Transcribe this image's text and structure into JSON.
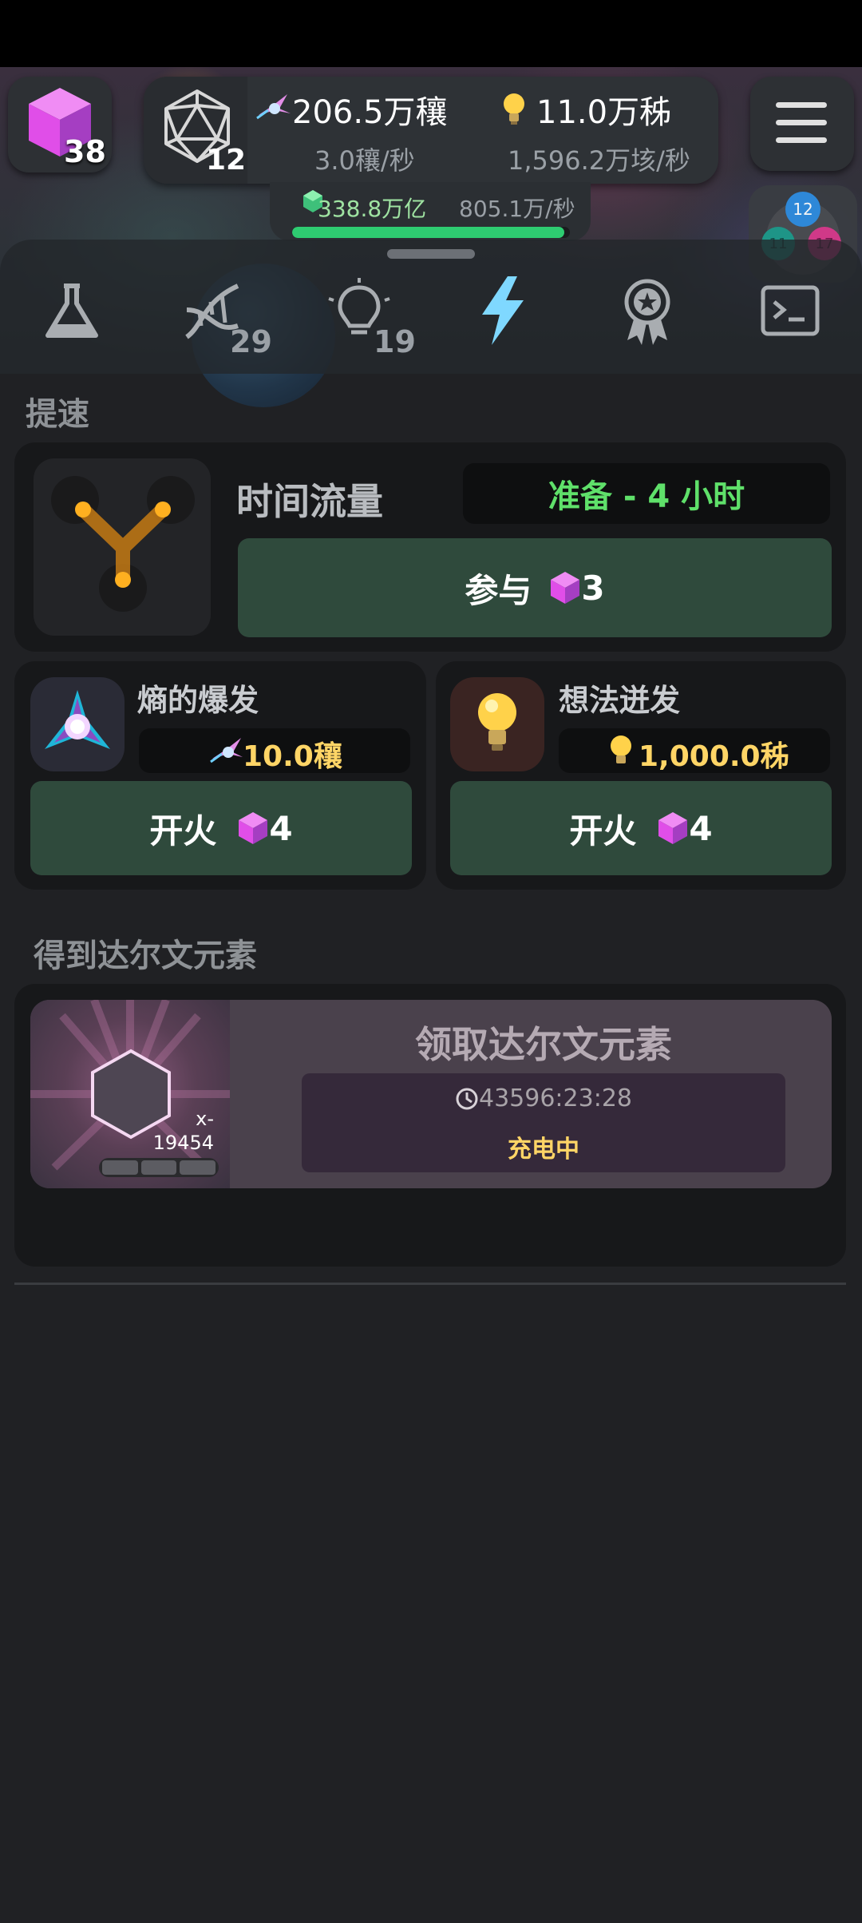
{
  "header": {
    "gem_count": "38",
    "d20_count": "12",
    "entropy_amount": "206.5万穰",
    "entropy_rate": "3.0穰/秒",
    "ideas_amount": "11.0万秭",
    "ideas_rate": "1,596.2万垓/秒",
    "gold_amount": "338.8万亿",
    "gold_rate": "805.1万/秒",
    "gold_progress": 0.98,
    "player_badge_top": "12",
    "player_badge_left": "11",
    "player_badge_right": "17"
  },
  "tabs": [
    {
      "icon": "flask-icon",
      "count": ""
    },
    {
      "icon": "dna-icon",
      "count": "29"
    },
    {
      "icon": "lightbulb-icon",
      "count": "19"
    },
    {
      "icon": "lightning-icon",
      "count": "",
      "active": true
    },
    {
      "icon": "award-icon",
      "count": ""
    },
    {
      "icon": "terminal-icon",
      "count": ""
    }
  ],
  "boost": {
    "section_title": "提速",
    "time_flow": {
      "title": "时间流量",
      "status": "准备 - 4 小时",
      "button_label": "参与",
      "cost": "3"
    },
    "entropy_burst": {
      "title": "熵的爆发",
      "amount": "10.0穰",
      "button_label": "开火",
      "cost": "4"
    },
    "idea_burst": {
      "title": "想法迸发",
      "amount": "1,000.0秭",
      "button_label": "开火",
      "cost": "4"
    }
  },
  "darwin": {
    "section_title": "得到达尔文元素",
    "claim_title": "领取达尔文元素",
    "multiplier": "x-\n19454",
    "timer": "43596:23:28",
    "status": "充电中"
  },
  "colors": {
    "accent_green": "#2f4a3c",
    "status_green": "#5fe06a",
    "gold_text": "#ffd566",
    "gem_purple": "#c54ed6"
  }
}
